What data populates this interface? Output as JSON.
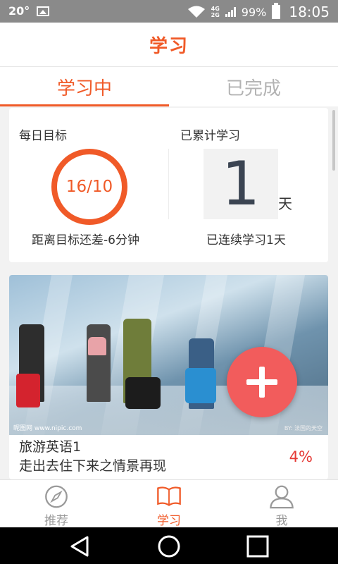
{
  "status_bar": {
    "temperature": "20°",
    "network_top": "4G",
    "network_bottom": "2G",
    "battery": "99%",
    "time": "18:05"
  },
  "header": {
    "title": "学习"
  },
  "tabs": [
    {
      "label": "学习中",
      "active": true
    },
    {
      "label": "已完成",
      "active": false
    }
  ],
  "stats": {
    "daily_goal_label": "每日目标",
    "daily_goal_value": "16/10",
    "daily_goal_note": "距离目标还差-6分钟",
    "total_label": "已累计学习",
    "total_days": "1",
    "total_unit": "天",
    "streak_note": "已连续学习1天"
  },
  "course": {
    "watermark_left": "昵图网 www.nipic.com",
    "watermark_right": "BY: 法国的天空",
    "title": "旅游英语1",
    "subtitle": "走出去住下来之情景再现",
    "progress": "4%"
  },
  "bottom_nav": [
    {
      "label": "推荐",
      "icon": "compass-icon",
      "active": false
    },
    {
      "label": "学习",
      "icon": "book-icon",
      "active": true
    },
    {
      "label": "我",
      "icon": "user-icon",
      "active": false
    }
  ],
  "colors": {
    "accent": "#f05a28",
    "fab": "#f25c5c",
    "progress": "#e53935"
  }
}
